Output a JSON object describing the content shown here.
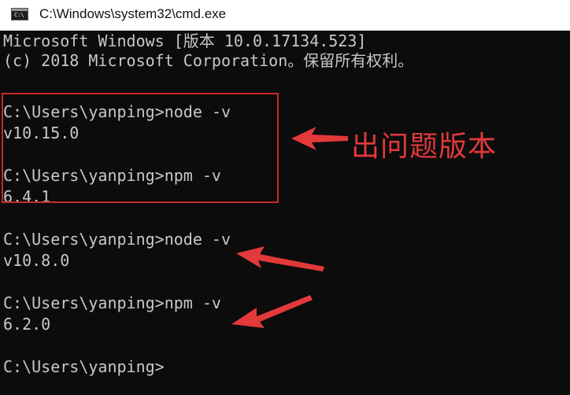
{
  "window": {
    "title": "C:\\Windows\\system32\\cmd.exe",
    "icon": "cmd-icon",
    "icon_text": "C:\\"
  },
  "console": {
    "lines": [
      "Microsoft Windows [版本 10.0.17134.523]",
      "(c) 2018 Microsoft Corporation。保留所有权利。",
      "",
      "C:\\Users\\yanping>node -v",
      "v10.15.0",
      "",
      "C:\\Users\\yanping>npm -v",
      "6.4.1",
      "",
      "C:\\Users\\yanping>node -v",
      "v10.8.0",
      "",
      "C:\\Users\\yanping>npm -v",
      "6.2.0",
      "",
      "C:\\Users\\yanping>"
    ]
  },
  "annotation": {
    "label": "出问题版本",
    "color": "#e2393b",
    "box_color": "#c9292b"
  },
  "colors": {
    "background": "#0c0c0c",
    "text": "#c8c8c8",
    "titlebar": "#ffffff"
  }
}
